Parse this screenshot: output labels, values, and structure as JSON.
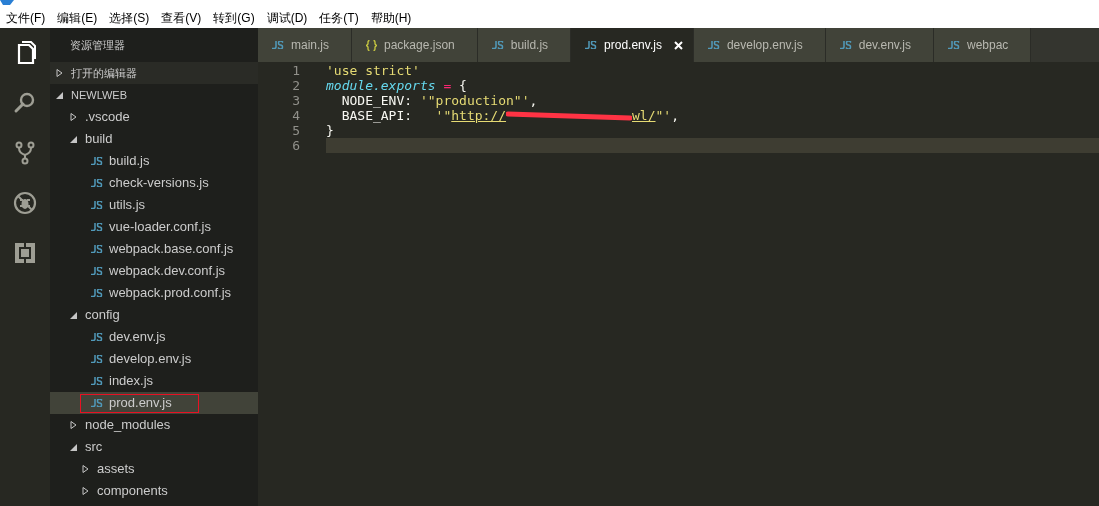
{
  "menu": [
    "文件(F)",
    "编辑(E)",
    "选择(S)",
    "查看(V)",
    "转到(G)",
    "调试(D)",
    "任务(T)",
    "帮助(H)"
  ],
  "activity_bar": [
    {
      "kind": "explorer",
      "selected": true
    },
    {
      "kind": "search",
      "selected": false
    },
    {
      "kind": "git",
      "selected": false
    },
    {
      "kind": "debug",
      "selected": false
    },
    {
      "kind": "extensions",
      "selected": false
    }
  ],
  "sidebar": {
    "title": "资源管理器",
    "sections": [
      {
        "label": "打开的编辑器",
        "expanded": false
      },
      {
        "label": "NEWLWEB",
        "expanded": true
      }
    ],
    "tree": [
      {
        "kind": "folder",
        "label": ".vscode",
        "expanded": false
      },
      {
        "kind": "folder",
        "label": "build",
        "expanded": true,
        "children": [
          {
            "kind": "file",
            "label": "build.js",
            "selected": false
          },
          {
            "kind": "file",
            "label": "check-versions.js",
            "selected": false
          },
          {
            "kind": "file",
            "label": "utils.js",
            "selected": false
          },
          {
            "kind": "file",
            "label": "vue-loader.conf.js",
            "selected": false
          },
          {
            "kind": "file",
            "label": "webpack.base.conf.js",
            "selected": false
          },
          {
            "kind": "file",
            "label": "webpack.dev.conf.js",
            "selected": false
          },
          {
            "kind": "file",
            "label": "webpack.prod.conf.js",
            "selected": false
          }
        ]
      },
      {
        "kind": "folder",
        "label": "config",
        "expanded": true,
        "children": [
          {
            "kind": "file",
            "label": "dev.env.js",
            "selected": false
          },
          {
            "kind": "file",
            "label": "develop.env.js",
            "selected": false
          },
          {
            "kind": "file",
            "label": "index.js",
            "selected": false
          },
          {
            "kind": "file",
            "label": "prod.env.js",
            "selected": true,
            "marked": true
          }
        ]
      },
      {
        "kind": "folder",
        "label": "node_modules",
        "expanded": false
      },
      {
        "kind": "folder",
        "label": "src",
        "expanded": true,
        "children": [
          {
            "kind": "folder",
            "label": "assets",
            "expanded": false
          },
          {
            "kind": "folder",
            "label": "components",
            "expanded": false
          }
        ]
      }
    ]
  },
  "tabs": [
    {
      "kind": "js",
      "label": "main.js",
      "selected": false
    },
    {
      "kind": "json",
      "label": "package.json",
      "selected": false
    },
    {
      "kind": "js",
      "label": "build.js",
      "selected": false
    },
    {
      "kind": "js",
      "label": "prod.env.js",
      "selected": true
    },
    {
      "kind": "js",
      "label": "develop.env.js",
      "selected": false
    },
    {
      "kind": "js",
      "label": "dev.env.js",
      "selected": false
    },
    {
      "kind": "js",
      "label": "webpac",
      "selected": false
    }
  ],
  "editor": {
    "lines": [
      {
        "number": "1",
        "current": false,
        "tokens": [
          {
            "kind": "string",
            "text": "'use strict'"
          }
        ]
      },
      {
        "number": "2",
        "current": false,
        "tokens": [
          {
            "kind": "keyword",
            "text": "module.exports"
          },
          {
            "kind": "operator",
            "text": " ="
          },
          {
            "kind": "plain",
            "text": " {"
          }
        ]
      },
      {
        "number": "3",
        "current": false,
        "tokens": [
          {
            "kind": "plain",
            "text": "  NODE_ENV: "
          },
          {
            "kind": "string",
            "text": "'\"production\"'"
          },
          {
            "kind": "plain",
            "text": ","
          }
        ]
      },
      {
        "number": "4",
        "current": false,
        "tokens": [
          {
            "kind": "plain",
            "text": "  BASE_API:   "
          },
          {
            "kind": "string",
            "text": "'\""
          },
          {
            "kind": "link",
            "text": "http://"
          },
          {
            "kind": "redacted"
          },
          {
            "kind": "link",
            "text": "wl/"
          },
          {
            "kind": "string",
            "text": "\"'"
          },
          {
            "kind": "plain",
            "text": ","
          }
        ]
      },
      {
        "number": "5",
        "current": false,
        "tokens": [
          {
            "kind": "plain",
            "text": "}"
          }
        ]
      },
      {
        "number": "6",
        "current": true
      }
    ]
  }
}
